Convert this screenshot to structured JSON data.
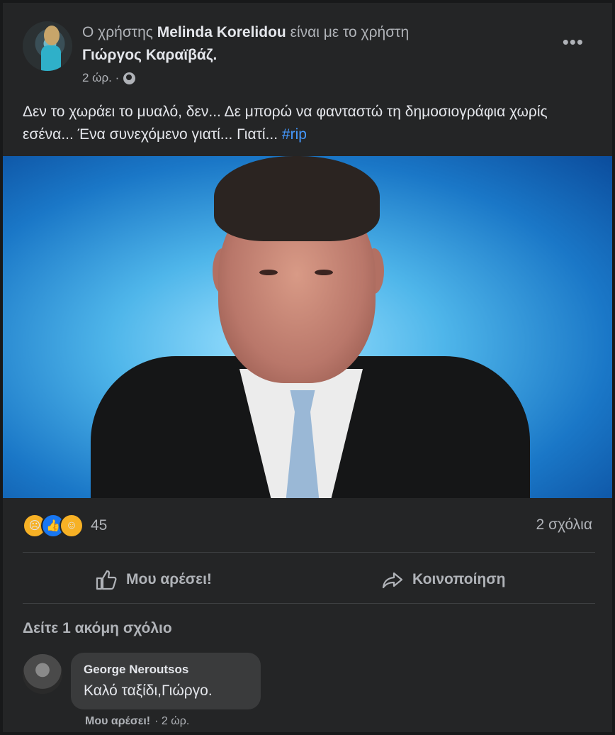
{
  "post": {
    "header_prefix": "Ο χρήστης",
    "author": "Melinda Korelidou",
    "header_middle": "είναι με το χρήστη",
    "tagged": "Γιώργος Καραϊβάζ.",
    "time": "2 ώρ. ·",
    "privacy_icon": "globe-icon",
    "more_label": "•••",
    "text": "Δεν το χωράει το μυαλό, δεν... Δε μπορώ να φανταστώ τη δημοσιογράφια χωρίς εσένα... Ένα συνεχόμενο γιατί... Γιατί...",
    "hashtag": "#rip"
  },
  "reactions": {
    "icons": [
      "sad-icon",
      "like-icon",
      "wow-icon"
    ],
    "count": "45",
    "comments_count": "2 σχόλια"
  },
  "actions": {
    "like_label": "Μου αρέσει!",
    "share_label": "Κοινοποίηση"
  },
  "comments": {
    "more_label": "Δείτε 1 ακόμη σχόλιο",
    "items": [
      {
        "author": "George Neroutsos",
        "text": "Καλό ταξίδι,Γιώργο.",
        "like_label": "Μου αρέσει!",
        "time": "· 2 ώρ."
      }
    ]
  },
  "colors": {
    "background": "#242526",
    "link": "#4599ff",
    "muted": "#b0b3b8",
    "text": "#e4e6eb"
  }
}
